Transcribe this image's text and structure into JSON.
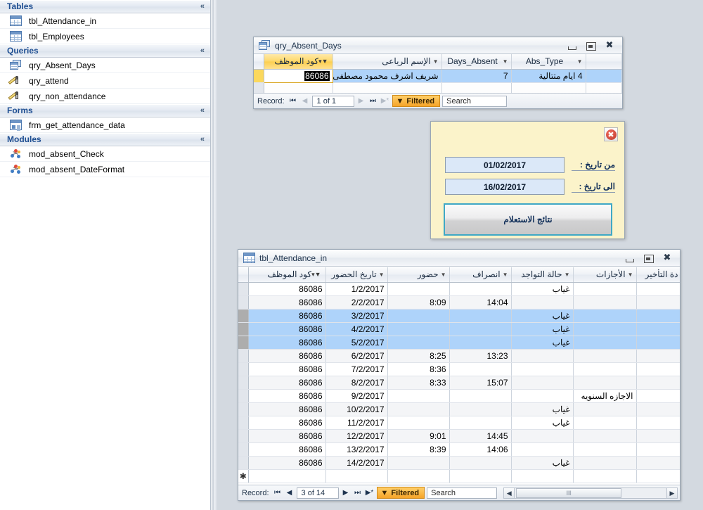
{
  "nav_pane": {
    "groups": [
      {
        "title": "Tables",
        "icon": "table-icon",
        "items": [
          {
            "label": "tbl_Attendance_in",
            "icon": "table-icon"
          },
          {
            "label": "tbl_Employees",
            "icon": "table-icon"
          }
        ]
      },
      {
        "title": "Queries",
        "items": [
          {
            "label": "qry_Absent_Days",
            "icon": "crosstab-query-icon"
          },
          {
            "label": "qry_attend",
            "icon": "select-query-icon"
          },
          {
            "label": "qry_non_attendance",
            "icon": "select-query-icon"
          }
        ]
      },
      {
        "title": "Forms",
        "items": [
          {
            "label": "frm_get_attendance_data",
            "icon": "form-icon"
          }
        ]
      },
      {
        "title": "Modules",
        "items": [
          {
            "label": "mod_absent_Check",
            "icon": "module-icon"
          },
          {
            "label": "mod_absent_DateFormat",
            "icon": "module-icon"
          }
        ]
      }
    ],
    "collapse_glyph": "«"
  },
  "query_window": {
    "title": "qry_Absent_Days",
    "icon": "query-datasheet-icon",
    "buttons": {
      "minimize": "minimize-icon",
      "restore": "restore-icon",
      "close": "✖"
    },
    "columns": [
      {
        "label": "كود الموظف",
        "filtered": true,
        "rtl": true
      },
      {
        "label": "الإسم الرياعى",
        "filtered": false,
        "rtl": true
      },
      {
        "label": "Days_Absent",
        "filtered": false,
        "rtl": false
      },
      {
        "label": "Abs_Type",
        "filtered": false,
        "rtl": false
      }
    ],
    "rows": [
      {
        "emp_code": "86086",
        "name": "شريف اشرف محمود مصطفى",
        "days_absent": "7",
        "abs_type": "4 ايام متتالية"
      }
    ],
    "navigation": {
      "record_label": "Record:",
      "position": "1 of 1",
      "first": "⏮",
      "prev": "◀",
      "next": "▶",
      "last": "⏭",
      "new": "▶*",
      "filter_label": "Filtered",
      "filter_icon": "filter-funnel-icon",
      "search_placeholder": "Search"
    }
  },
  "popup_form": {
    "title_icon": "close-icon",
    "close_glyph": "✖",
    "fields": [
      {
        "label": "من تاريخ :",
        "value": "01/02/2017"
      },
      {
        "label": "الى تاريخ :",
        "value": "16/02/2017"
      }
    ],
    "submit_label": "نتائج الاستعلام"
  },
  "table_window": {
    "title": "tbl_Attendance_in",
    "icon": "table-icon",
    "buttons": {
      "minimize": "minimize-icon",
      "restore": "restore-icon",
      "close": "✖"
    },
    "columns": [
      {
        "label": "كود الموظف",
        "filtered": true,
        "rtl": true
      },
      {
        "label": "تاريخ الحضور",
        "filtered": false,
        "rtl": true
      },
      {
        "label": "حضور",
        "filtered": false,
        "rtl": true
      },
      {
        "label": "انصراف",
        "filtered": false,
        "rtl": true
      },
      {
        "label": "حالة التواجد",
        "filtered": false,
        "rtl": true
      },
      {
        "label": "الأجازات",
        "filtered": false,
        "rtl": true
      },
      {
        "label": "دة التأخير",
        "filtered": false,
        "rtl": true,
        "clipped": true
      }
    ],
    "rows": [
      {
        "emp_code": "86086",
        "date": "1/2/2017",
        "in": "",
        "out": "",
        "status": "غياب",
        "leave": "",
        "late": "",
        "selected": false
      },
      {
        "emp_code": "86086",
        "date": "2/2/2017",
        "in": "8:09",
        "out": "14:04",
        "status": "",
        "leave": "",
        "late": "",
        "selected": false
      },
      {
        "emp_code": "86086",
        "date": "3/2/2017",
        "in": "",
        "out": "",
        "status": "غياب",
        "leave": "",
        "late": "",
        "selected": true
      },
      {
        "emp_code": "86086",
        "date": "4/2/2017",
        "in": "",
        "out": "",
        "status": "غياب",
        "leave": "",
        "late": "",
        "selected": true
      },
      {
        "emp_code": "86086",
        "date": "5/2/2017",
        "in": "",
        "out": "",
        "status": "غياب",
        "leave": "",
        "late": "",
        "selected": true
      },
      {
        "emp_code": "86086",
        "date": "6/2/2017",
        "in": "8:25",
        "out": "13:23",
        "status": "",
        "leave": "",
        "late": "",
        "selected": false
      },
      {
        "emp_code": "86086",
        "date": "7/2/2017",
        "in": "8:36",
        "out": "",
        "status": "",
        "leave": "",
        "late": "",
        "selected": false
      },
      {
        "emp_code": "86086",
        "date": "8/2/2017",
        "in": "8:33",
        "out": "15:07",
        "status": "",
        "leave": "",
        "late": "",
        "selected": false
      },
      {
        "emp_code": "86086",
        "date": "9/2/2017",
        "in": "",
        "out": "",
        "status": "",
        "leave": "الاجازه السنويه",
        "late": "",
        "selected": false
      },
      {
        "emp_code": "86086",
        "date": "10/2/2017",
        "in": "",
        "out": "",
        "status": "غياب",
        "leave": "",
        "late": "",
        "selected": false
      },
      {
        "emp_code": "86086",
        "date": "11/2/2017",
        "in": "",
        "out": "",
        "status": "غياب",
        "leave": "",
        "late": "",
        "selected": false
      },
      {
        "emp_code": "86086",
        "date": "12/2/2017",
        "in": "9:01",
        "out": "14:45",
        "status": "",
        "leave": "",
        "late": "",
        "selected": false
      },
      {
        "emp_code": "86086",
        "date": "13/2/2017",
        "in": "8:39",
        "out": "14:06",
        "status": "",
        "leave": "",
        "late": "",
        "selected": false
      },
      {
        "emp_code": "86086",
        "date": "14/2/2017",
        "in": "",
        "out": "",
        "status": "غياب",
        "leave": "",
        "late": "",
        "selected": false
      }
    ],
    "new_record_glyph": "✱",
    "navigation": {
      "record_label": "Record:",
      "position": "3 of 14",
      "first": "⏮",
      "prev": "◀",
      "next": "▶",
      "last": "⏭",
      "new": "▶*",
      "filter_label": "Filtered",
      "filter_icon": "filter-funnel-icon",
      "search_placeholder": "Search",
      "scroll_left": "◀",
      "scroll_right": "▶",
      "thumb_grip": "‖‖"
    }
  },
  "colors": {
    "workspace_bg": "#d3d9e0",
    "accent_blue": "#1f4f92",
    "filter_orange": "#f6a428",
    "selection_blue": "#aed3fa",
    "form_yellow": "#fbf3ca",
    "form_input_blue": "#dbe8f8",
    "button_border_teal": "#3fa8c6"
  }
}
